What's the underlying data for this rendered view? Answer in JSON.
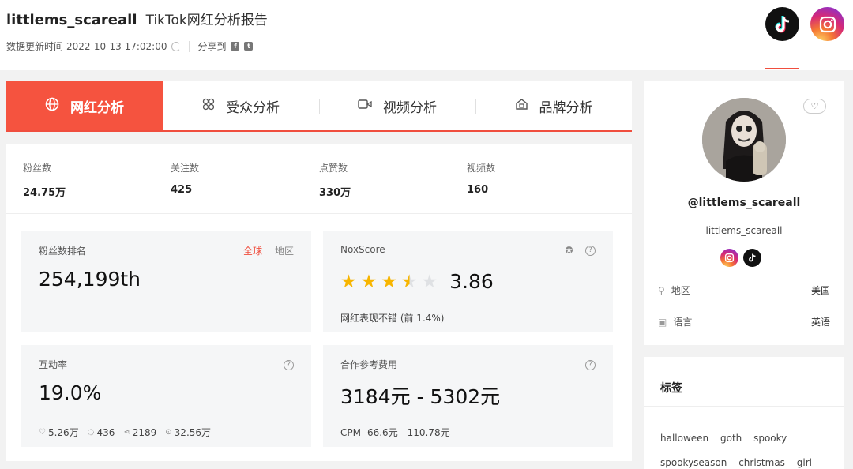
{
  "header": {
    "username": "littlems_scareall",
    "report_title": "TikTok网红分析报告",
    "updated_label": "数据更新时间",
    "updated_time": "2022-10-13 17:02:00",
    "share_label": "分享到",
    "share_icons": [
      "facebook-icon",
      "twitter-icon"
    ],
    "platforms": [
      "tiktok-icon",
      "instagram-icon"
    ],
    "active_platform": "tiktok"
  },
  "tabs": [
    {
      "label": "网红分析",
      "icon": "globe-icon",
      "active": true
    },
    {
      "label": "受众分析",
      "icon": "audience-icon",
      "active": false
    },
    {
      "label": "视频分析",
      "icon": "video-icon",
      "active": false
    },
    {
      "label": "品牌分析",
      "icon": "brand-icon",
      "active": false
    }
  ],
  "stats": [
    {
      "label": "粉丝数",
      "value": "24.75万"
    },
    {
      "label": "关注数",
      "value": "425"
    },
    {
      "label": "点赞数",
      "value": "330万"
    },
    {
      "label": "视频数",
      "value": "160"
    }
  ],
  "follower_rank": {
    "label": "粉丝数排名",
    "value": "254,199th",
    "scope_global": "全球",
    "scope_region": "地区",
    "active_scope": "global"
  },
  "nox_score": {
    "label": "NoxScore",
    "rating": 3.86,
    "rating_text": "3.86",
    "max": 5,
    "note": "网红表现不错 (前 1.4%)"
  },
  "engagement": {
    "label": "互动率",
    "value": "19.0%",
    "likes": "5.26万",
    "comments": "436",
    "shares": "2189",
    "views": "32.56万"
  },
  "cost": {
    "label": "合作参考费用",
    "value": "3184元 - 5302元",
    "cpm_label": "CPM",
    "cpm_value": "66.6元 - 110.78元"
  },
  "profile": {
    "handle": "@littlems_scareall",
    "nickname": "littlems_scareall",
    "region_label": "地区",
    "region_value": "美国",
    "language_label": "语言",
    "language_value": "英语"
  },
  "tags": {
    "title": "标签",
    "items": [
      "halloween",
      "goth",
      "spooky",
      "spookyseason",
      "christmas",
      "girl"
    ]
  },
  "colors": {
    "accent": "#f04e3e",
    "tab_active": "#f5533f",
    "star": "#f7b500",
    "card_bg": "#f5f6f7"
  }
}
